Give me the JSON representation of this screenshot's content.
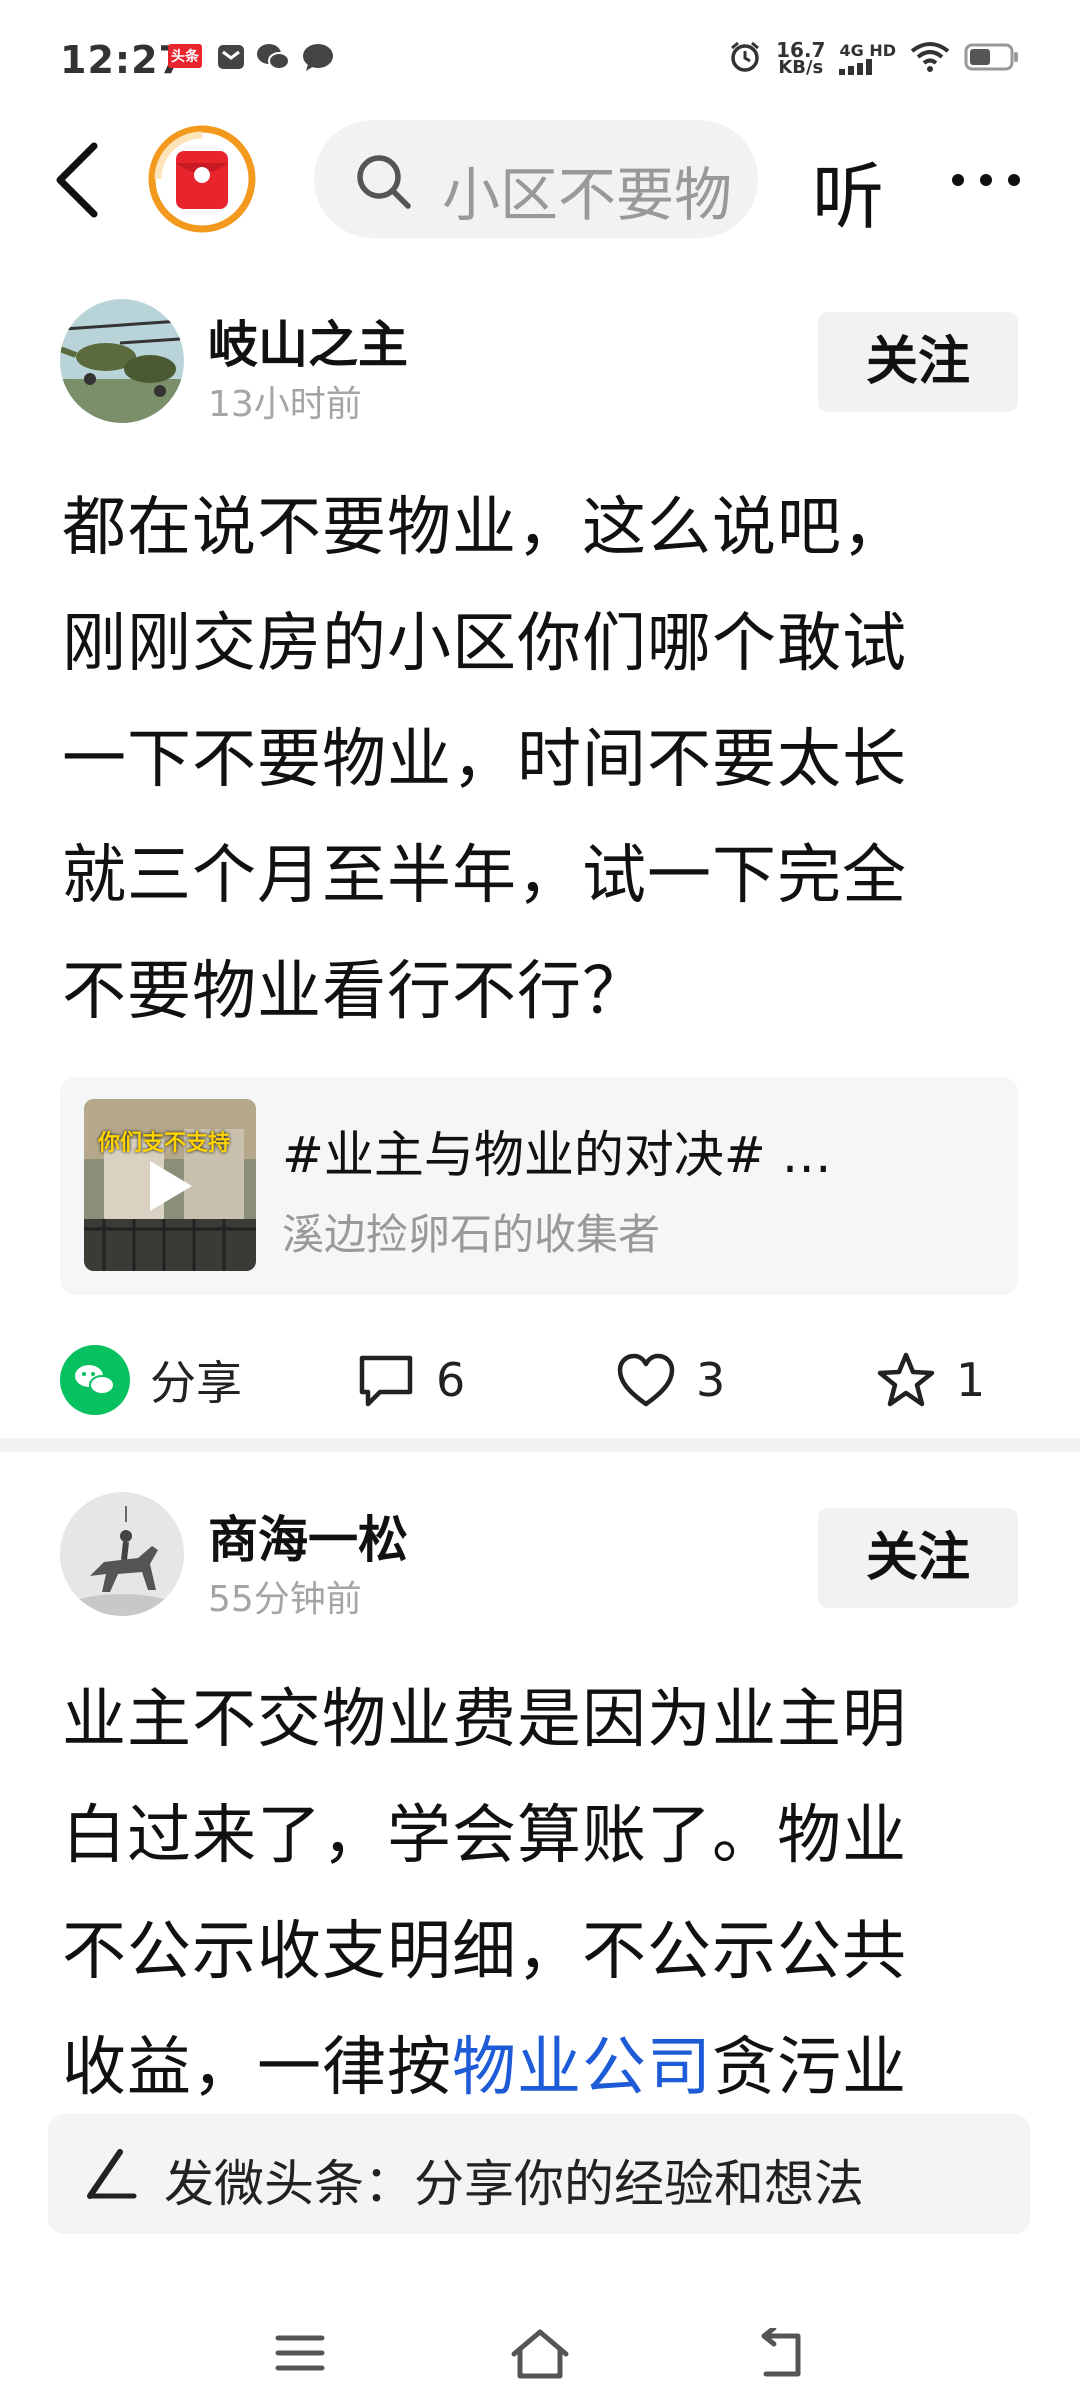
{
  "status_bar": {
    "time": "12:27",
    "app_badge": "头条",
    "speed_top": "16.7",
    "speed_bottom": "KB/s",
    "network": "4G HD"
  },
  "nav": {
    "search_text": "小区不要物业",
    "listen_label": "听"
  },
  "posts": [
    {
      "author": "岐山之主",
      "time": "13小时前",
      "follow_label": "关注",
      "lines": [
        "都在说不要物业，这么说吧，",
        "刚刚交房的小区你们哪个敢试",
        "一下不要物业，时间不要太长",
        "就三个月至半年，试一下完全",
        "不要物业看行不行？"
      ],
      "card": {
        "title": "#业主与物业的对决# …",
        "author": "溪边捡卵石的收集者",
        "thumb_caption": "你们支不支持"
      },
      "share_label": "分享",
      "comments": "6",
      "likes": "3",
      "favorites": "1"
    },
    {
      "author": "商海一松",
      "time": "55分钟前",
      "follow_label": "关注",
      "lines": [
        "业主不交物业费是因为业主明",
        "白过来了，学会算账了。物业",
        "不公示收支明细，不公示公共"
      ],
      "line4_prefix": "收益，一律按",
      "line4_link": "物业公司",
      "line4_suffix": "贪污业"
    }
  ],
  "compose": {
    "text": "发微头条：分享你的经验和想法"
  },
  "colors": {
    "link": "#1e5bd6",
    "wechat_green": "#07c160",
    "accent_red": "#e8242d",
    "orange_ring": "#f39a1e"
  }
}
